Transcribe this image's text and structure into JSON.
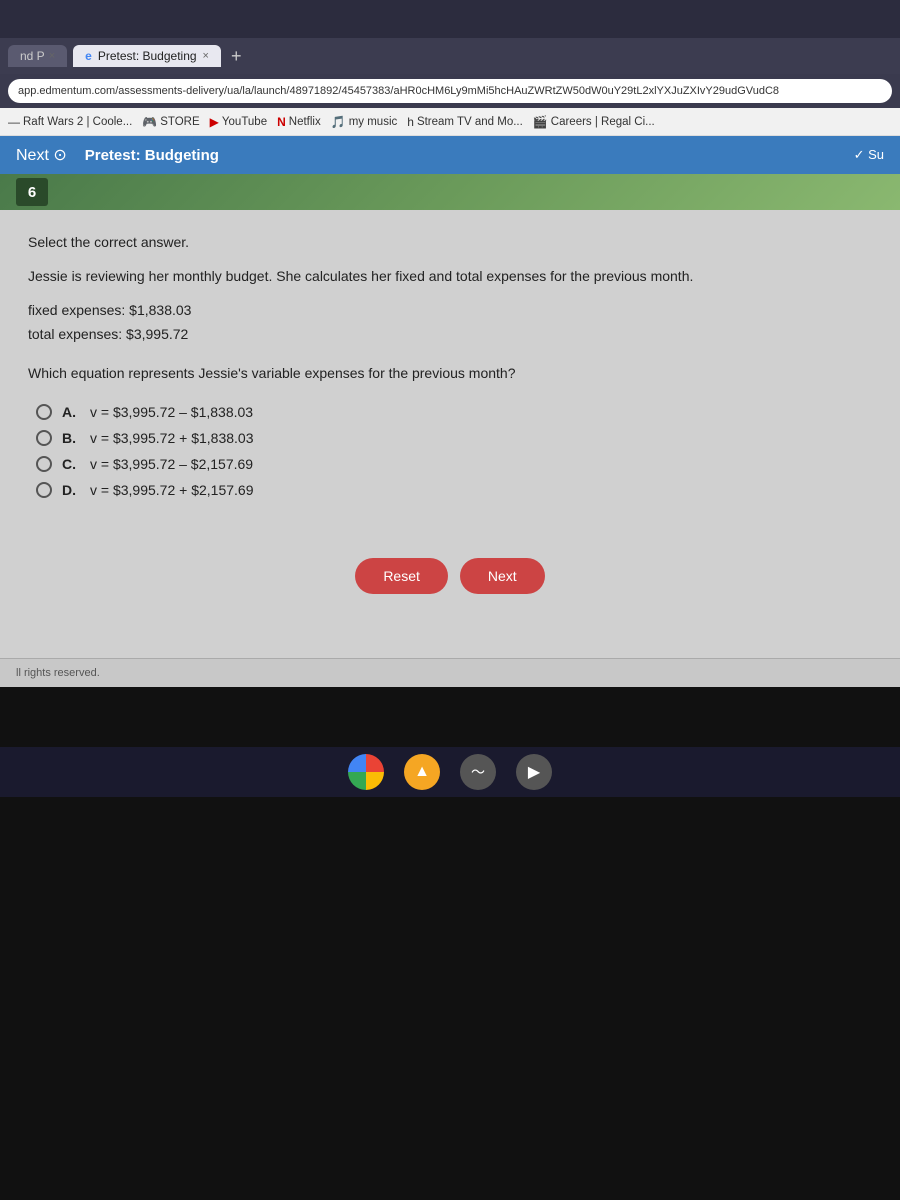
{
  "browser": {
    "tab_inactive_label": "nd P",
    "tab_active_label": "Pretest: Budgeting",
    "tab_active_icon": "e",
    "tab_close_label": "×",
    "tab_add_label": "+",
    "address_url": "app.edmentum.com/assessments-delivery/ua/la/launch/48971892/45457383/aHR0cHM6Ly9mMi5hcHAuZWRtZW50dW0uY29tL2xlYXJuZXIvY29udGVudC8",
    "bookmarks": [
      {
        "label": "Raft Wars 2 | Coole...",
        "icon": "—"
      },
      {
        "label": "STORE",
        "icon": "🎮"
      },
      {
        "label": "YouTube",
        "icon": "▶"
      },
      {
        "label": "Netflix",
        "icon": "N"
      },
      {
        "label": "my music",
        "icon": "🎵"
      },
      {
        "label": "Stream TV and Mo...",
        "icon": "h"
      },
      {
        "label": "Careers | Regal Ci...",
        "icon": "🎬"
      }
    ]
  },
  "page_header": {
    "nav_label": "Next ⊙",
    "title": "Pretest: Budgeting",
    "sub_label": "✓ Su"
  },
  "question": {
    "number": "6",
    "instruction": "Select the correct answer.",
    "scenario": "Jessie is reviewing her monthly budget. She calculates her fixed and total expenses for the previous month.",
    "data_lines": [
      "fixed expenses: $1,838.03",
      "total expenses: $3,995.72"
    ],
    "question_text": "Which equation represents Jessie's variable expenses for the previous month?",
    "choices": [
      {
        "letter": "A.",
        "equation": "v = $3,995.72 – $1,838.03"
      },
      {
        "letter": "B.",
        "equation": "v = $3,995.72 + $1,838.03"
      },
      {
        "letter": "C.",
        "equation": "v = $3,995.72 – $2,157.69"
      },
      {
        "letter": "D.",
        "equation": "v = $3,995.72 + $2,157.69"
      }
    ]
  },
  "buttons": {
    "reset_label": "Reset",
    "next_label": "Next"
  },
  "footer": {
    "text": "ll rights reserved."
  },
  "taskbar": {
    "icons": [
      "chrome",
      "triangle",
      "wifi",
      "play"
    ]
  }
}
